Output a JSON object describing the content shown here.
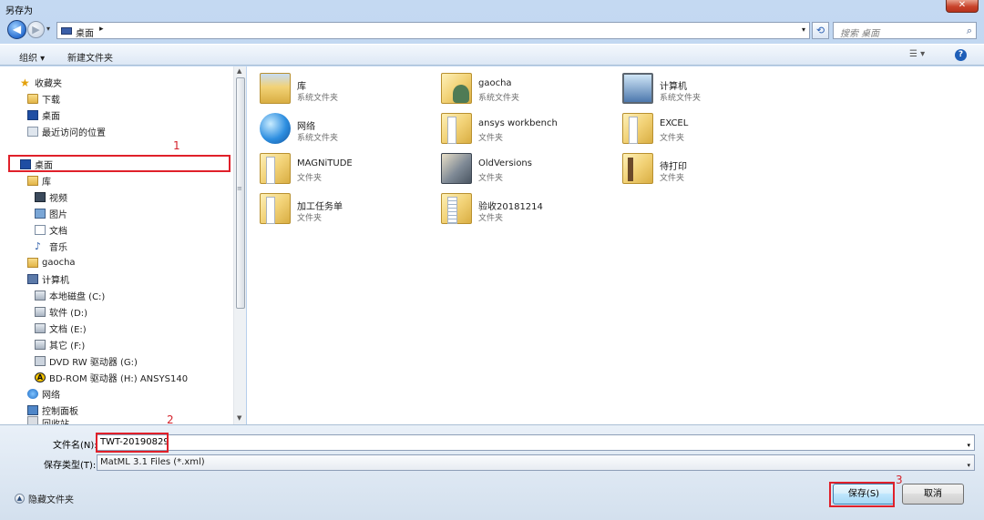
{
  "window": {
    "title": "另存为",
    "close_glyph": "✕"
  },
  "address": {
    "back_glyph": "◀",
    "forward_glyph": "▶",
    "recent_glyph": "▾",
    "crumb": "桌面",
    "crumb_arrow": "▸",
    "dropdown_glyph": "▾",
    "refresh_glyph": "⟲",
    "search_placeholder": "搜索 桌面",
    "search_glyph": "⌕"
  },
  "toolbar": {
    "organize_label": "组织 ▾",
    "new_folder_label": "新建文件夹",
    "view_label": "☰ ▾",
    "help_label": "?"
  },
  "nav": {
    "favorites_label": "收藏夹",
    "downloads_label": "下载",
    "desktop_fav_label": "桌面",
    "recent_label": "最近访问的位置",
    "desktop_label": "桌面",
    "libraries_label": "库",
    "videos_label": "视频",
    "pictures_label": "图片",
    "documents_label": "文档",
    "music_label": "音乐",
    "user_label": "gaocha",
    "computer_label": "计算机",
    "drive_c_label": "本地磁盘 (C:)",
    "drive_d_label": "软件 (D:)",
    "drive_e_label": "文档 (E:)",
    "drive_f_label": "其它 (F:)",
    "drive_g_label": "DVD RW 驱动器 (G:)",
    "drive_h_label": "BD-ROM 驱动器 (H:) ANSYS140",
    "network_label": "网络",
    "control_label": "控制面板",
    "recycle_label": "回收站",
    "star_glyph": "★",
    "music_glyph": "♪",
    "ansys_glyph": "A"
  },
  "files": [
    {
      "name": "库",
      "type": "系统文件夹",
      "icon": "library-folder-icon"
    },
    {
      "name": "gaocha",
      "type": "系统文件夹",
      "icon": "user-folder-icon"
    },
    {
      "name": "计算机",
      "type": "系统文件夹",
      "icon": "computer-icon"
    },
    {
      "name": "网络",
      "type": "系统文件夹",
      "icon": "network-globe-icon"
    },
    {
      "name": "ansys workbench",
      "type": "文件夹",
      "icon": "folder-icon"
    },
    {
      "name": "EXCEL",
      "type": "文件夹",
      "icon": "folder-icon"
    },
    {
      "name": "MAGNiTUDE",
      "type": "文件夹",
      "icon": "folder-icon"
    },
    {
      "name": "OldVersions",
      "type": "文件夹",
      "icon": "dark-folder-icon"
    },
    {
      "name": "待打印",
      "type": "文件夹",
      "icon": "print-folder-icon"
    },
    {
      "name": "加工任务单",
      "type": "文件夹",
      "icon": "folder-icon"
    },
    {
      "name": "验收20181214",
      "type": "文件夹",
      "icon": "document-folder-icon"
    }
  ],
  "bottom": {
    "filename_label": "文件名(N):",
    "filename_value": "TWT-20190829",
    "filetype_label": "保存类型(T):",
    "filetype_value": "MatML 3.1 Files (*.xml)",
    "hide_folders_label": "隐藏文件夹",
    "hide_folders_glyph": "▲",
    "save_label": "保存(S)",
    "cancel_label": "取消",
    "dropdown_glyph": "▾"
  },
  "annotations": {
    "mark_1": "1",
    "mark_2": "2",
    "mark_3": "3"
  },
  "scroll": {
    "up_glyph": "▲",
    "down_glyph": "▼",
    "grip_glyph": "≡"
  },
  "colors": {
    "annotation_red": "#e0202a",
    "accent_blue": "#3c7fb1"
  }
}
